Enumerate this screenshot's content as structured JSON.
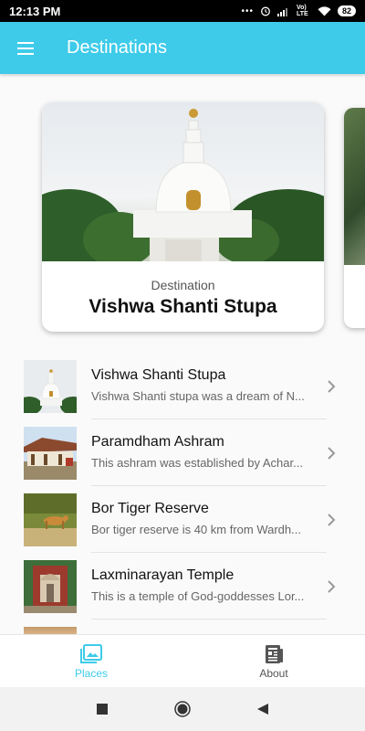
{
  "status_bar": {
    "time": "12:13 PM",
    "dots": "•••",
    "network": "Vo) LTE",
    "battery": "82"
  },
  "app_bar": {
    "title": "Destinations",
    "menu_icon": "hamburger-menu-icon",
    "background": "#3ecbe9"
  },
  "featured": {
    "subtitle": "Destination",
    "title": "Vishwa Shanti Stupa"
  },
  "places": [
    {
      "title": "Vishwa Shanti Stupa",
      "description": "Vishwa Shanti stupa was a dream of N..."
    },
    {
      "title": "Paramdham Ashram",
      "description": "This ashram was established by Achar..."
    },
    {
      "title": "Bor Tiger Reserve",
      "description": "Bor tiger reserve is 40 km from Wardh..."
    },
    {
      "title": "Laxminarayan Temple",
      "description": "This is a temple of God-goddesses Lor..."
    }
  ],
  "bottom_nav": {
    "items": [
      {
        "label": "Places",
        "icon": "photo-library-icon",
        "active": true
      },
      {
        "label": "About",
        "icon": "newspaper-icon",
        "active": false
      }
    ],
    "accent": "#3ecbe9"
  },
  "system_nav": {
    "buttons": [
      "square-recents-icon",
      "circle-home-icon",
      "triangle-back-icon"
    ]
  }
}
